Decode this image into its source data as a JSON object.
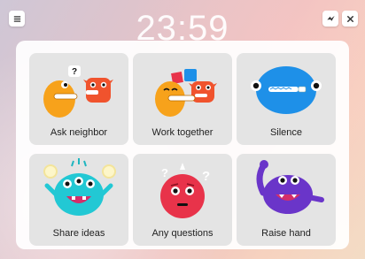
{
  "clock": {
    "time": "23:59"
  },
  "topbar": {
    "menu_icon": "hamburger-menu-icon",
    "mode_icon": "lightning-icon",
    "close_icon": "close-icon"
  },
  "tiles": [
    {
      "label": "Ask neighbor",
      "mascot": "two-mascots-question-icon"
    },
    {
      "label": "Work together",
      "mascot": "two-mascots-collaborate-icon"
    },
    {
      "label": "Silence",
      "mascot": "blue-zipped-mouth-mascot-icon"
    },
    {
      "label": "Share ideas",
      "mascot": "teal-lightbulb-mascot-icon"
    },
    {
      "label": "Any questions",
      "mascot": "red-question-mascot-icon"
    },
    {
      "label": "Raise hand",
      "mascot": "purple-raise-hand-mascot-icon"
    }
  ],
  "colors": {
    "orange": "#f7a21b",
    "red_orange": "#f0532d",
    "blue": "#1e90e8",
    "teal": "#22c8d4",
    "red": "#e8334a",
    "purple": "#6a35c9"
  }
}
